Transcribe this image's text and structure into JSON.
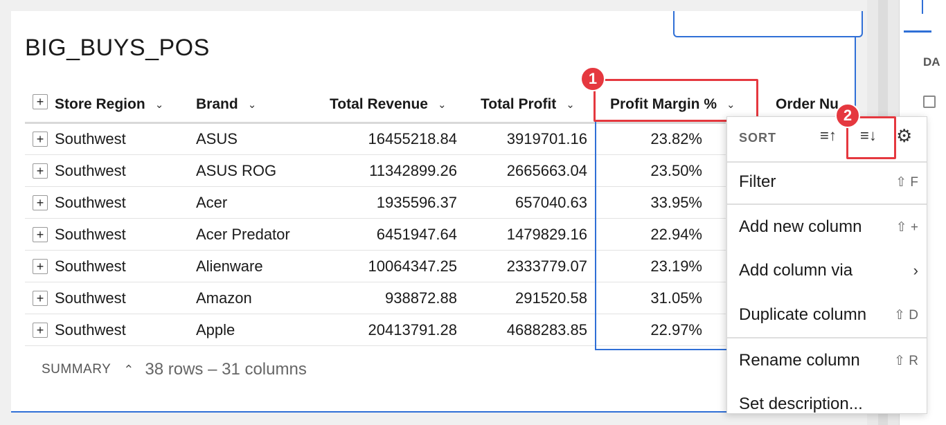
{
  "table": {
    "title": "BIG_BUYS_POS",
    "columns": {
      "store_region": "Store Region",
      "brand": "Brand",
      "total_revenue": "Total Revenue",
      "total_profit": "Total Profit",
      "profit_margin": "Profit Margin %",
      "order_number": "Order Nu"
    },
    "rows": [
      {
        "region": "Southwest",
        "brand": "ASUS",
        "revenue": "16455218.84",
        "profit": "3919701.16",
        "margin": "23.82%"
      },
      {
        "region": "Southwest",
        "brand": "ASUS ROG",
        "revenue": "11342899.26",
        "profit": "2665663.04",
        "margin": "23.50%"
      },
      {
        "region": "Southwest",
        "brand": "Acer",
        "revenue": "1935596.37",
        "profit": "657040.63",
        "margin": "33.95%"
      },
      {
        "region": "Southwest",
        "brand": "Acer Predator",
        "revenue": "6451947.64",
        "profit": "1479829.16",
        "margin": "22.94%"
      },
      {
        "region": "Southwest",
        "brand": "Alienware",
        "revenue": "10064347.25",
        "profit": "2333779.07",
        "margin": "23.19%"
      },
      {
        "region": "Southwest",
        "brand": "Amazon",
        "revenue": "938872.88",
        "profit": "291520.58",
        "margin": "31.05%"
      },
      {
        "region": "Southwest",
        "brand": "Apple",
        "revenue": "20413791.28",
        "profit": "4688283.85",
        "margin": "22.97%"
      }
    ],
    "summary_label": "SUMMARY",
    "summary_counts": "38 rows – 31 columns"
  },
  "menu": {
    "sort_label": "SORT",
    "filter": "Filter",
    "filter_shortcut": "⇧ F",
    "add_new_column": "Add new column",
    "add_new_column_shortcut": "⇧ +",
    "add_column_via": "Add column via",
    "duplicate_column": "Duplicate column",
    "duplicate_shortcut": "⇧ D",
    "rename_column": "Rename column",
    "rename_shortcut": "⇧ R",
    "set_description": "Set description..."
  },
  "callouts": {
    "one": "1",
    "two": "2"
  },
  "sidebar": {
    "tab_label": "DA"
  }
}
